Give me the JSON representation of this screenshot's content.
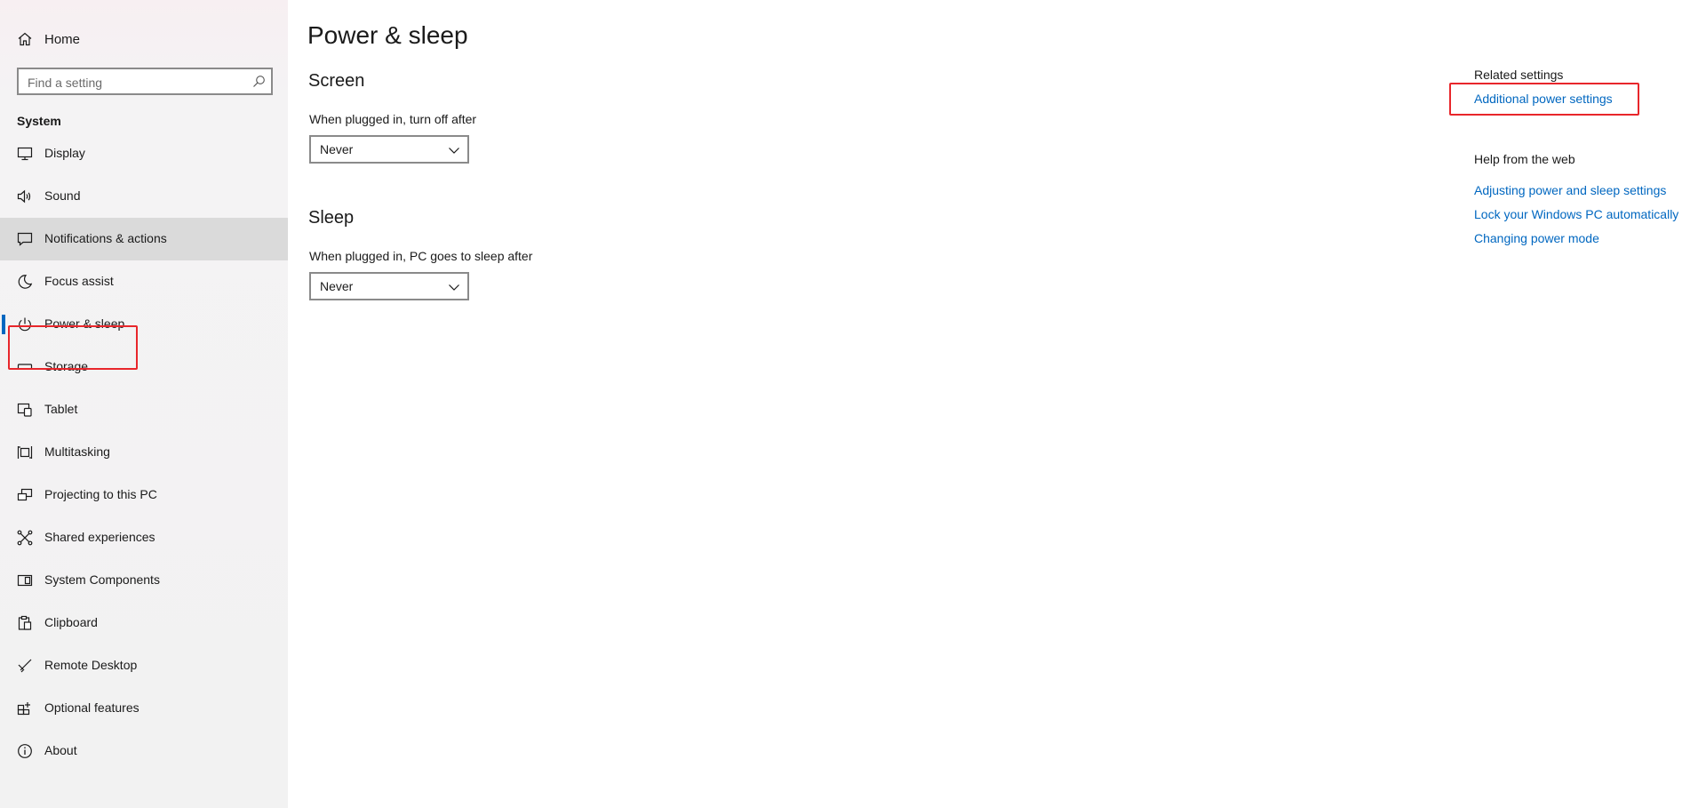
{
  "sidebar": {
    "home_label": "Home",
    "search_placeholder": "Find a setting",
    "section_title": "System",
    "items": [
      {
        "label": "Display",
        "icon": "monitor-icon"
      },
      {
        "label": "Sound",
        "icon": "speaker-icon"
      },
      {
        "label": "Notifications & actions",
        "icon": "notification-icon"
      },
      {
        "label": "Focus assist",
        "icon": "moon-icon"
      },
      {
        "label": "Power & sleep",
        "icon": "power-icon"
      },
      {
        "label": "Storage",
        "icon": "storage-icon"
      },
      {
        "label": "Tablet",
        "icon": "tablet-icon"
      },
      {
        "label": "Multitasking",
        "icon": "multitasking-icon"
      },
      {
        "label": "Projecting to this PC",
        "icon": "projecting-icon"
      },
      {
        "label": "Shared experiences",
        "icon": "shared-experiences-icon"
      },
      {
        "label": "System Components",
        "icon": "system-components-icon"
      },
      {
        "label": "Clipboard",
        "icon": "clipboard-icon"
      },
      {
        "label": "Remote Desktop",
        "icon": "remote-desktop-icon"
      },
      {
        "label": "Optional features",
        "icon": "optional-features-icon"
      },
      {
        "label": "About",
        "icon": "info-icon"
      }
    ],
    "selected_index": 4,
    "hover_index": 2
  },
  "main": {
    "title": "Power & sleep",
    "screen": {
      "heading": "Screen",
      "label": "When plugged in, turn off after",
      "value": "Never"
    },
    "sleep": {
      "heading": "Sleep",
      "label": "When plugged in, PC goes to sleep after",
      "value": "Never"
    }
  },
  "related": {
    "related_heading": "Related settings",
    "related_links": [
      "Additional power settings"
    ],
    "help_heading": "Help from the web",
    "help_links": [
      "Adjusting power and sleep settings",
      "Lock your Windows PC automatically",
      "Changing power mode"
    ]
  },
  "colors": {
    "accent": "#0067c0",
    "annotation": "#e8262b",
    "hover": "#dadada"
  }
}
